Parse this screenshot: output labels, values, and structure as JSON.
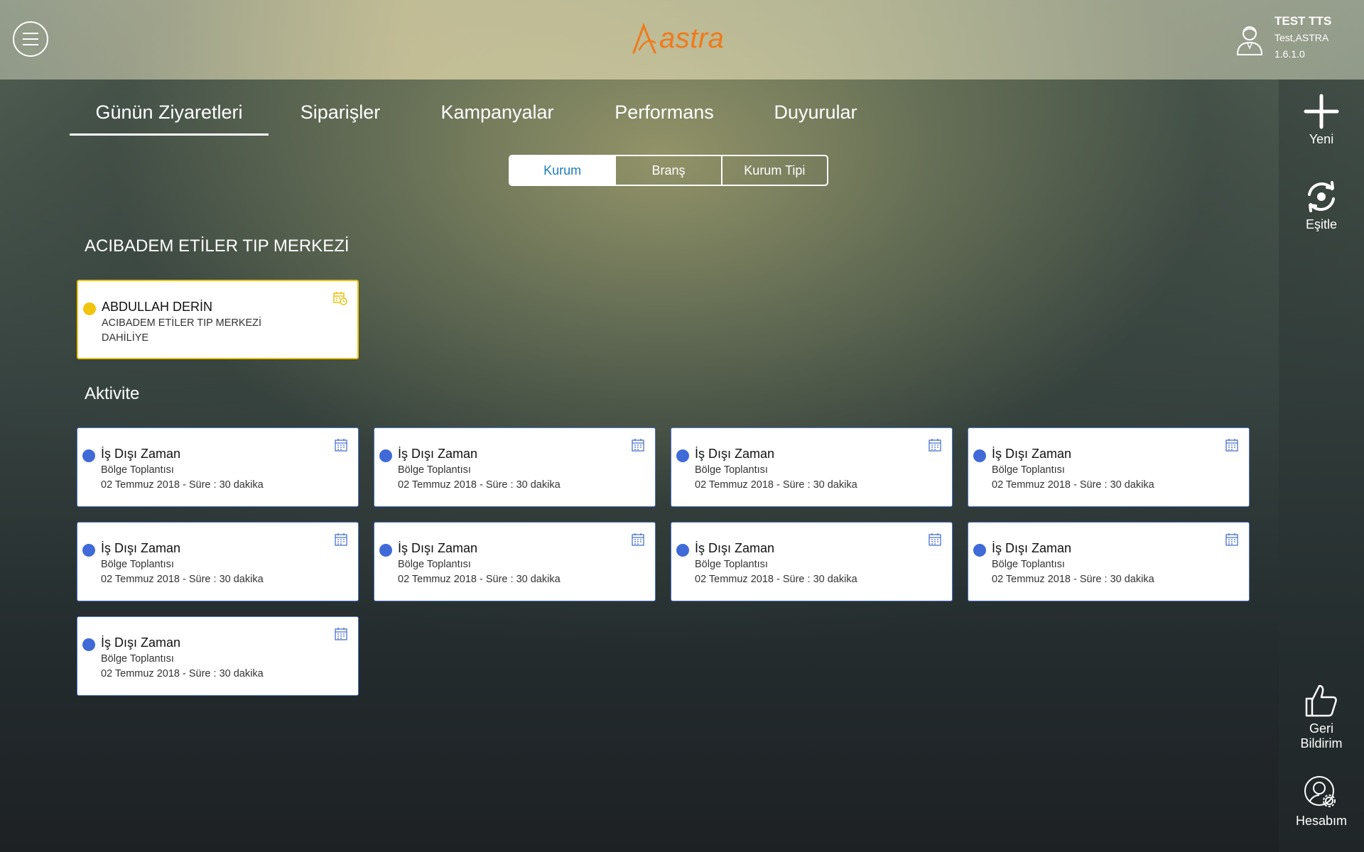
{
  "header": {
    "logo_text": "astra",
    "user": {
      "name": "TEST TTS",
      "account": "Test,ASTRA",
      "version": "1.6.1.0"
    }
  },
  "tabs": [
    {
      "label": "Günün Ziyaretleri",
      "active": true
    },
    {
      "label": "Siparişler",
      "active": false
    },
    {
      "label": "Kampanyalar",
      "active": false
    },
    {
      "label": "Performans",
      "active": false
    },
    {
      "label": "Duyurular",
      "active": false
    }
  ],
  "segments": [
    {
      "label": "Kurum",
      "active": true
    },
    {
      "label": "Branş",
      "active": false
    },
    {
      "label": "Kurum Tipi",
      "active": false
    }
  ],
  "rail": {
    "new_label": "Yeni",
    "sync_label": "Eşitle",
    "feedback_label_1": "Geri",
    "feedback_label_2": "Bildirim",
    "account_label": "Hesabım"
  },
  "colors": {
    "accent_orange": "#f07a19",
    "visit_yellow": "#f1c40f",
    "activity_blue": "#3f6ad8",
    "segment_active_text": "#1c7fb8"
  },
  "institution": {
    "title": "ACIBADEM ETİLER TIP MERKEZİ",
    "visits": [
      {
        "name": "ABDULLAH DERİN",
        "institution": "ACIBADEM ETİLER TIP MERKEZİ",
        "branch": "DAHİLİYE",
        "icon": "calendar-clock-icon"
      }
    ]
  },
  "activity": {
    "title": "Aktivite",
    "items": [
      {
        "title": "İş Dışı Zaman",
        "type": "Bölge Toplantısı",
        "detail": "02 Temmuz 2018 - Süre : 30 dakika"
      },
      {
        "title": "İş Dışı Zaman",
        "type": "Bölge Toplantısı",
        "detail": "02 Temmuz 2018 - Süre : 30 dakika"
      },
      {
        "title": "İş Dışı Zaman",
        "type": "Bölge Toplantısı",
        "detail": "02 Temmuz 2018 - Süre : 30 dakika"
      },
      {
        "title": "İş Dışı Zaman",
        "type": "Bölge Toplantısı",
        "detail": "02 Temmuz 2018 - Süre : 30 dakika"
      },
      {
        "title": "İş Dışı Zaman",
        "type": "Bölge Toplantısı",
        "detail": "02 Temmuz 2018 - Süre : 30 dakika"
      },
      {
        "title": "İş Dışı Zaman",
        "type": "Bölge Toplantısı",
        "detail": "02 Temmuz 2018 - Süre : 30 dakika"
      },
      {
        "title": "İş Dışı Zaman",
        "type": "Bölge Toplantısı",
        "detail": "02 Temmuz 2018 - Süre : 30 dakika"
      },
      {
        "title": "İş Dışı Zaman",
        "type": "Bölge Toplantısı",
        "detail": "02 Temmuz 2018 - Süre : 30 dakika"
      },
      {
        "title": "İş Dışı Zaman",
        "type": "Bölge Toplantısı",
        "detail": "02 Temmuz 2018 - Süre : 30 dakika"
      }
    ]
  }
}
